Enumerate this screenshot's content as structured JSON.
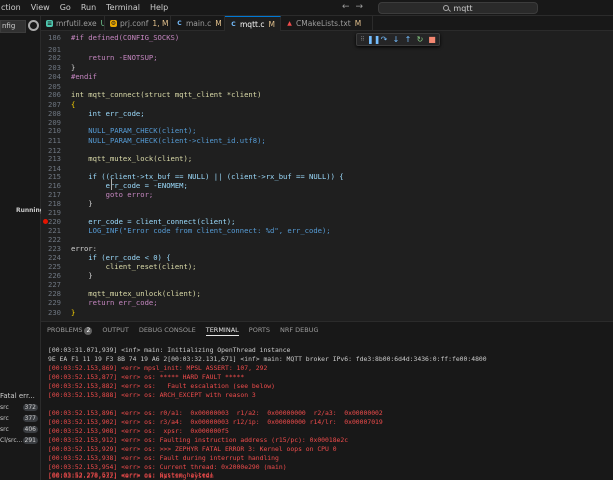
{
  "menu": [
    "ction",
    "View",
    "Go",
    "Run",
    "Terminal",
    "Help"
  ],
  "search": {
    "text": "mqtt",
    "icon": "search-icon"
  },
  "nav": {
    "back": "←",
    "forward": "→"
  },
  "sidebar": {
    "config_select": "nfig",
    "status": "Running",
    "fatal_label": "Fatal err...",
    "rows": [
      {
        "label": "src",
        "count": "372"
      },
      {
        "label": "src",
        "count": "377"
      },
      {
        "label": "src",
        "count": "406"
      },
      {
        "label": "Cl/src...",
        "count": "291"
      }
    ]
  },
  "tabs": [
    {
      "label": "mrfutil.exe",
      "status": "U",
      "icon_color": "#4ec9b0",
      "icon": "file-icon"
    },
    {
      "label": "prj.conf",
      "status": "1, M",
      "icon_color": "#e9a700",
      "icon": "settings-file-icon"
    },
    {
      "label": "main.c",
      "status": "M",
      "icon_color": "#75beff",
      "icon": "c-file-icon"
    },
    {
      "label": "mqtt.c",
      "status": "M",
      "icon_color": "#75beff",
      "icon": "c-file-icon",
      "active": true
    },
    {
      "label": "CMakeLists.txt",
      "status": "M",
      "icon_color": "#f14c4c",
      "icon": "cmake-file-icon"
    }
  ],
  "editor": {
    "lines": [
      {
        "n": "186",
        "t": "#if defined(CONFIG_SOCKS)"
      },
      {
        "n": "201",
        "t": ""
      },
      {
        "n": "202",
        "t": "    return -ENOTSUP;"
      },
      {
        "n": "203",
        "t": "}"
      },
      {
        "n": "204",
        "t": "#endif"
      },
      {
        "n": "205",
        "t": ""
      },
      {
        "n": "206",
        "t": "int mqtt_connect(struct mqtt_client *client)"
      },
      {
        "n": "207",
        "t": "{"
      },
      {
        "n": "208",
        "t": "    int err_code;"
      },
      {
        "n": "209",
        "t": ""
      },
      {
        "n": "210",
        "t": "    NULL_PARAM_CHECK(client);"
      },
      {
        "n": "211",
        "t": "    NULL_PARAM_CHECK(client->client_id.utf8);"
      },
      {
        "n": "212",
        "t": ""
      },
      {
        "n": "213",
        "t": "    mqtt_mutex_lock(client);"
      },
      {
        "n": "214",
        "t": ""
      },
      {
        "n": "215",
        "t": "    if ((client->tx_buf == NULL) || (client->rx_buf == NULL)) {"
      },
      {
        "n": "216",
        "t": "        err_code = -ENOMEM;"
      },
      {
        "n": "217",
        "t": "        goto error;"
      },
      {
        "n": "218",
        "t": "    }"
      },
      {
        "n": "219",
        "t": ""
      },
      {
        "n": "220",
        "t": "    err_code = client_connect(client);"
      },
      {
        "n": "221",
        "t": "    LOG_INF(\"Error code from client_connect: %d\", err_code);"
      },
      {
        "n": "222",
        "t": ""
      },
      {
        "n": "223",
        "t": "error:"
      },
      {
        "n": "224",
        "t": "    if (err_code < 0) {"
      },
      {
        "n": "225",
        "t": "        client_reset(client);"
      },
      {
        "n": "226",
        "t": "    }"
      },
      {
        "n": "227",
        "t": ""
      },
      {
        "n": "228",
        "t": "    mqtt_mutex_unlock(client);"
      },
      {
        "n": "229",
        "t": "    return err_code;"
      },
      {
        "n": "230",
        "t": "}"
      }
    ],
    "breakpoint_line": "220"
  },
  "debug_toolbar": [
    "grip-icon",
    "pause-icon",
    "step-over-icon",
    "step-into-icon",
    "step-out-icon",
    "restart-icon",
    "stop-icon"
  ],
  "panel": {
    "tabs": [
      {
        "label": "PROBLEMS",
        "count": "2"
      },
      {
        "label": "OUTPUT"
      },
      {
        "label": "DEBUG CONSOLE"
      },
      {
        "label": "TERMINAL",
        "active": true
      },
      {
        "label": "PORTS"
      },
      {
        "label": "NRF DEBUG"
      }
    ],
    "terminal": [
      {
        "t": "[00:03:31.071,939] <inf> main: Initializing OpenThread instance",
        "err": false
      },
      {
        "t": "9E EA F1 11 19 F3 8B 74 19 A6 2[00:03:32.131,671] <inf> main: MQTT broker IPv6: fde3:8b00:6d4d:3436:0:ff:fe00:4800",
        "err": false
      },
      {
        "t": "[00:03:52.153,869] <err> mpsl_init: MPSL ASSERT: 107, 292",
        "err": true
      },
      {
        "t": "[00:03:52.153,877] <err> os: ***** HARD FAULT *****",
        "err": true
      },
      {
        "t": "[00:03:52.153,882] <err> os:   Fault escalation (see below)",
        "err": true
      },
      {
        "t": "[00:03:52.153,888] <err> os: ARCH_EXCEPT with reason 3",
        "err": true
      },
      {
        "t": "",
        "err": false
      },
      {
        "t": "[00:03:52.153,896] <err> os: r0/a1:  0x00000003  r1/a2:  0x00000000  r2/a3:  0x00000002",
        "err": true
      },
      {
        "t": "[00:03:52.153,902] <err> os: r3/a4:  0x00000003 r12/ip:  0x00000000 r14/lr:  0x00007019",
        "err": true
      },
      {
        "t": "[00:03:52.153,908] <err> os:  xpsr:  0x000000f5",
        "err": true
      },
      {
        "t": "[00:03:52.153,912] <err> os: Faulting instruction address (r15/pc): 0x00018e2c",
        "err": true
      },
      {
        "t": "[00:03:52.153,929] <err> os: >>> ZEPHYR FATAL ERROR 3: Kernel oops on CPU 0",
        "err": true
      },
      {
        "t": "[00:03:52.153,938] <err> os: Fault during interrupt handling",
        "err": true
      },
      {
        "t": "",
        "err": false
      },
      {
        "t": "[00:03:52.153,954] <err> os: Current thread: 0x2000e290 (main)",
        "err": true
      },
      {
        "t": "[00:03:52.270,932] <err> os: Halting system",
        "err": true
      },
      {
        "t": "[00:03:52.278,577] <err> os: System halted!",
        "err": true
      }
    ]
  }
}
